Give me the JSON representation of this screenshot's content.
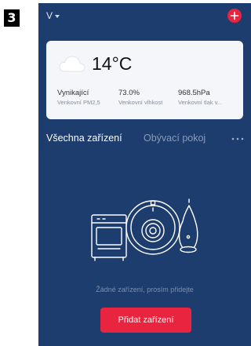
{
  "step": {
    "number": "3"
  },
  "header": {
    "home_name": "V",
    "add_icon": "plus-icon",
    "accent_color": "#e8243e"
  },
  "weather": {
    "icon": "cloud-icon",
    "temperature": "14°C",
    "stats": [
      {
        "value": "Vynikající",
        "label": "Venkovní PM2,5"
      },
      {
        "value": "73.0%",
        "label": "Venkovní vlhkost"
      },
      {
        "value": "968.5hPa",
        "label": "Venkovní tlak v..."
      }
    ]
  },
  "tabs": {
    "all_devices": "Všechna zařízení",
    "living_room": "Obývací pokoj",
    "more_icon": "more-dots-icon"
  },
  "empty_state": {
    "illustration": "devices-illustration",
    "message": "Žádné zařízení, prosím přidejte",
    "add_button_label": "Přidat zařízení"
  },
  "colors": {
    "background": "#1d3d6e",
    "card": "#f4f6f9",
    "accent": "#e8243e"
  }
}
